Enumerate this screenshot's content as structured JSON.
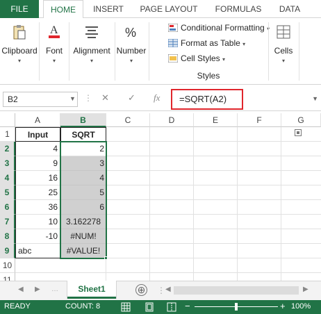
{
  "ribbon_tabs": [
    "FILE",
    "HOME",
    "INSERT",
    "PAGE LAYOUT",
    "FORMULAS",
    "DATA"
  ],
  "groups": {
    "clipboard": "Clipboard",
    "font": "Font",
    "alignment": "Alignment",
    "number": "Number",
    "styles": "Styles",
    "cells": "Cells"
  },
  "styles_items": {
    "conditional": "Conditional Formatting",
    "format_table": "Format as Table",
    "cell_styles": "Cell Styles"
  },
  "formula_bar": {
    "name_box": "B2",
    "cancel": "✕",
    "enter": "✓",
    "fx": "fx",
    "formula": "=SQRT(A2)"
  },
  "columns": [
    "A",
    "B",
    "C",
    "D",
    "E",
    "F",
    "G"
  ],
  "rows": [
    "1",
    "2",
    "3",
    "4",
    "5",
    "6",
    "7",
    "8",
    "9",
    "10",
    "11"
  ],
  "table": {
    "header_input": "Input",
    "header_sqrt": "SQRT",
    "inputs": [
      "4",
      "9",
      "16",
      "25",
      "36",
      "10",
      "-10",
      "abc"
    ],
    "results": [
      "2",
      "3",
      "4",
      "5",
      "6",
      "3.162278",
      "#NUM!",
      "#VALUE!"
    ]
  },
  "sheet_tab": "Sheet1",
  "add_sheet": "⊕",
  "status": {
    "mode": "READY",
    "count": "COUNT: 8",
    "zoom_minus": "−",
    "zoom_plus": "+",
    "zoom": "100%"
  },
  "colors": {
    "excel_green": "#217346",
    "highlight_red": "#e0262c",
    "selection_gray": "#c6c6c6"
  }
}
